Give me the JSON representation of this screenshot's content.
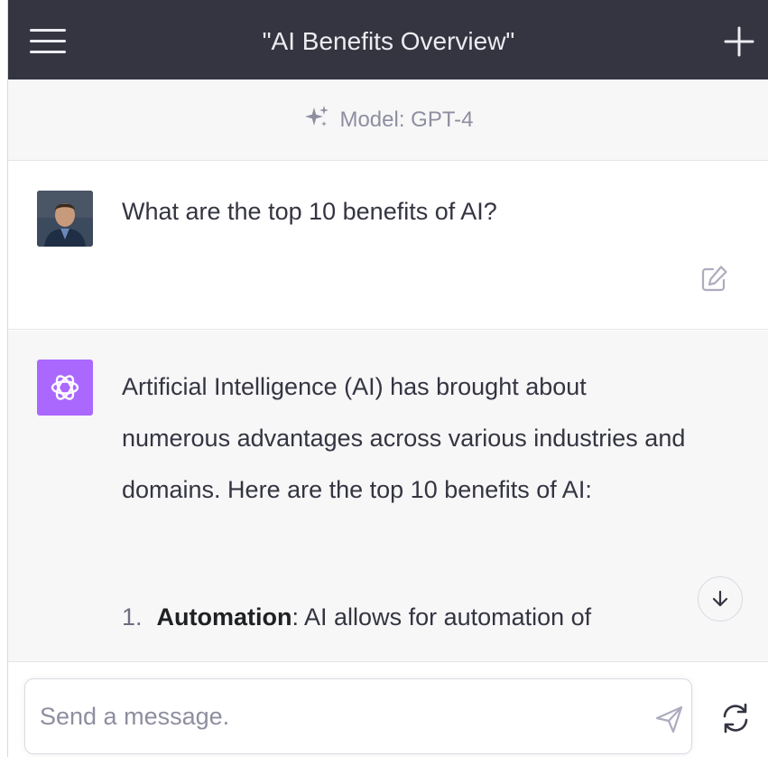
{
  "header": {
    "title": "\"AI Benefits Overview\"",
    "menu_icon": "hamburger-menu-icon",
    "new_chat_icon": "plus-icon"
  },
  "model_bar": {
    "label": "Model: GPT-4",
    "icon": "sparkle-icon"
  },
  "messages": [
    {
      "role": "user",
      "avatar": "user-avatar",
      "text": "What are the top 10 benefits of AI?",
      "edit_icon": "edit-icon"
    },
    {
      "role": "assistant",
      "avatar": "openai-logo-icon",
      "intro": "Artificial Intelligence (AI) has brought about numerous advantages across various industries and domains. Here are the top 10 benefits of AI:",
      "list": [
        {
          "number": "1.",
          "title": "Automation",
          "text": ": AI allows for automation of"
        }
      ]
    }
  ],
  "composer": {
    "placeholder": "Send a message.",
    "value": "",
    "send_icon": "send-icon",
    "regenerate_icon": "regenerate-icon",
    "scroll_icon": "arrow-down-icon"
  },
  "colors": {
    "header_bg": "#343541",
    "assistant_bg": "#f7f7f8",
    "gpt4_avatar": "#ab68ff",
    "text": "#343541"
  }
}
